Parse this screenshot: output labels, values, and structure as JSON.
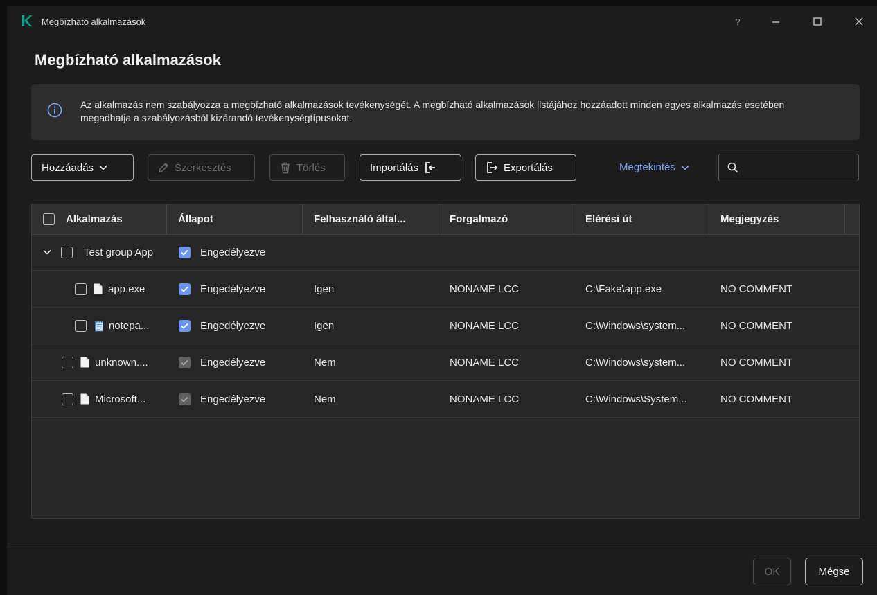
{
  "window": {
    "title": "Megbízható alkalmazások",
    "controls": {
      "help": "?",
      "minimize": "—",
      "maximize": "☐",
      "close": "✕"
    }
  },
  "page": {
    "heading": "Megbízható alkalmazások",
    "info_text": "Az alkalmazás nem szabályozza a megbízható alkalmazások tevékenységét. A megbízható alkalmazások listájához hozzáadott minden egyes alkalmazás esetében megadhatja a szabályozásból kizárandó tevékenységtípusokat."
  },
  "toolbar": {
    "add_label": "Hozzáadás",
    "edit_label": "Szerkesztés",
    "delete_label": "Törlés",
    "import_label": "Importálás",
    "export_label": "Exportálás",
    "view_label": "Megtekintés",
    "search_placeholder": ""
  },
  "table": {
    "columns": [
      "Alkalmazás",
      "Állapot",
      "Felhasználó által...",
      "Forgalmazó",
      "Elérési út",
      "Megjegyzés"
    ],
    "rows": [
      {
        "type": "group",
        "name": "Test group App",
        "status": "Engedélyezve",
        "status_checked": true,
        "status_enabled": true,
        "user": "",
        "vendor": "",
        "path": "",
        "comment": ""
      },
      {
        "type": "child",
        "icon": "file-icon",
        "name": "app.exe",
        "status": "Engedélyezve",
        "status_checked": true,
        "status_enabled": true,
        "user": "Igen",
        "vendor": "NONAME LCC",
        "path": "C:\\Fake\\app.exe",
        "comment": "NO COMMENT"
      },
      {
        "type": "child",
        "icon": "notepad-icon",
        "name": "notepa...",
        "status": "Engedélyezve",
        "status_checked": true,
        "status_enabled": true,
        "user": "Igen",
        "vendor": "NONAME LCC",
        "path": "C:\\Windows\\system...",
        "comment": "NO COMMENT"
      },
      {
        "type": "item",
        "icon": "file-icon",
        "name": "unknown....",
        "status": "Engedélyezve",
        "status_checked": true,
        "status_enabled": false,
        "user": "Nem",
        "vendor": "NONAME LCC",
        "path": "C:\\Windows\\system...",
        "comment": "NO COMMENT"
      },
      {
        "type": "item",
        "icon": "file-icon",
        "name": "Microsoft...",
        "status": "Engedélyezve",
        "status_checked": true,
        "status_enabled": false,
        "user": "Nem",
        "vendor": "NONAME LCC",
        "path": "C:\\Windows\\System...",
        "comment": "NO COMMENT"
      }
    ]
  },
  "footer": {
    "ok_label": "OK",
    "cancel_label": "Mégse"
  },
  "colors": {
    "accent": "#6b95ef",
    "link": "#7da3f2",
    "background": "#1c1c1c",
    "panel": "#2d2d2d",
    "logo": "#00a88e"
  }
}
